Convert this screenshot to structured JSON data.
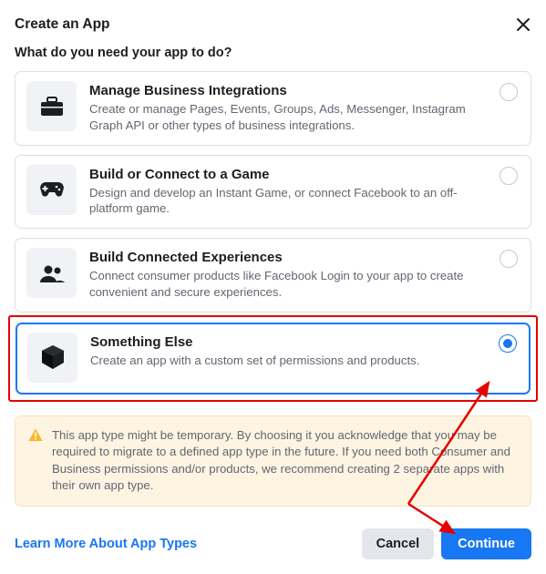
{
  "title": "Create an App",
  "question": "What do you need your app to do?",
  "options": [
    {
      "title": "Manage Business Integrations",
      "desc": "Create or manage Pages, Events, Groups, Ads, Messenger, Instagram Graph API or other types of business integrations.",
      "icon": "briefcase-icon"
    },
    {
      "title": "Build or Connect to a Game",
      "desc": "Design and develop an Instant Game, or connect Facebook to an off-platform game.",
      "icon": "gamepad-icon"
    },
    {
      "title": "Build Connected Experiences",
      "desc": "Connect consumer products like Facebook Login to your app to create convenient and secure experiences.",
      "icon": "people-icon"
    },
    {
      "title": "Something Else",
      "desc": "Create an app with a custom set of permissions and products.",
      "icon": "cube-icon"
    }
  ],
  "notice_text": "This app type might be temporary. By choosing it you acknowledge that you may be required to migrate to a defined app type in the future. If you need both Consumer and Business permissions and/or products, we recommend creating 2 separate apps with their own app type.",
  "learn_link": "Learn More About App Types",
  "cancel_label": "Cancel",
  "continue_label": "Continue"
}
